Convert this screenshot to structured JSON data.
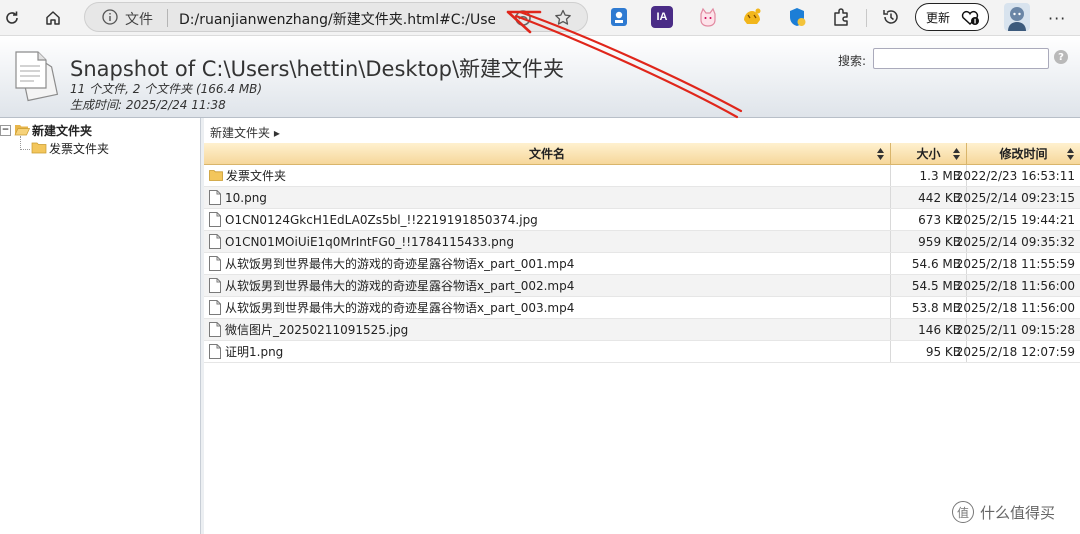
{
  "browser": {
    "info_label": "文件",
    "url": "D:/ruanjianwenzhang/新建文件夹.html#C:/Users...",
    "update_label": "更新",
    "ext_ia_label": "IA"
  },
  "header": {
    "title": "Snapshot of C:\\Users\\hettin\\Desktop\\新建文件夹",
    "stats": "11 个文件, 2 个文件夹 (166.4 MB)",
    "generated": "生成时间: 2025/2/24 11:38",
    "search_label": "搜索:",
    "search_value": "",
    "help_glyph": "?"
  },
  "tree": {
    "expander": "−",
    "root_label": "新建文件夹",
    "child_label": "发票文件夹"
  },
  "breadcrumb": "新建文件夹 ▸",
  "table": {
    "col_name": "文件名",
    "col_size": "大小",
    "col_date": "修改时间",
    "rows": [
      {
        "name": "发票文件夹",
        "size": "1.3 MB",
        "date": "2022/2/23 16:53:11",
        "type": "folder"
      },
      {
        "name": "10.png",
        "size": "442 KB",
        "date": "2025/2/14 09:23:15",
        "type": "file"
      },
      {
        "name": "O1CN0124GkcH1EdLA0Zs5bl_!!2219191850374.jpg",
        "size": "673 KB",
        "date": "2025/2/15 19:44:21",
        "type": "file"
      },
      {
        "name": "O1CN01MOiUiE1q0MrIntFG0_!!1784115433.png",
        "size": "959 KB",
        "date": "2025/2/14 09:35:32",
        "type": "file"
      },
      {
        "name": "从软饭男到世界最伟大的游戏的奇迹星露谷物语x_part_001.mp4",
        "size": "54.6 MB",
        "date": "2025/2/18 11:55:59",
        "type": "file"
      },
      {
        "name": "从软饭男到世界最伟大的游戏的奇迹星露谷物语x_part_002.mp4",
        "size": "54.5 MB",
        "date": "2025/2/18 11:56:00",
        "type": "file"
      },
      {
        "name": "从软饭男到世界最伟大的游戏的奇迹星露谷物语x_part_003.mp4",
        "size": "53.8 MB",
        "date": "2025/2/18 11:56:00",
        "type": "file"
      },
      {
        "name": "微信图片_20250211091525.jpg",
        "size": "146 KB",
        "date": "2025/2/11 09:15:28",
        "type": "file"
      },
      {
        "name": "证明1.png",
        "size": "95 KB",
        "date": "2025/2/18 12:07:59",
        "type": "file"
      }
    ]
  },
  "watermark": {
    "logo_glyph": "值",
    "text": "什么值得买"
  },
  "colors": {
    "annotation_arrow": "#e0261b",
    "header_gradient_bottom": "#dfe4ea",
    "table_head_top": "#fff1cf",
    "table_head_bottom": "#f6d79b",
    "folder": "#f0c25a"
  }
}
